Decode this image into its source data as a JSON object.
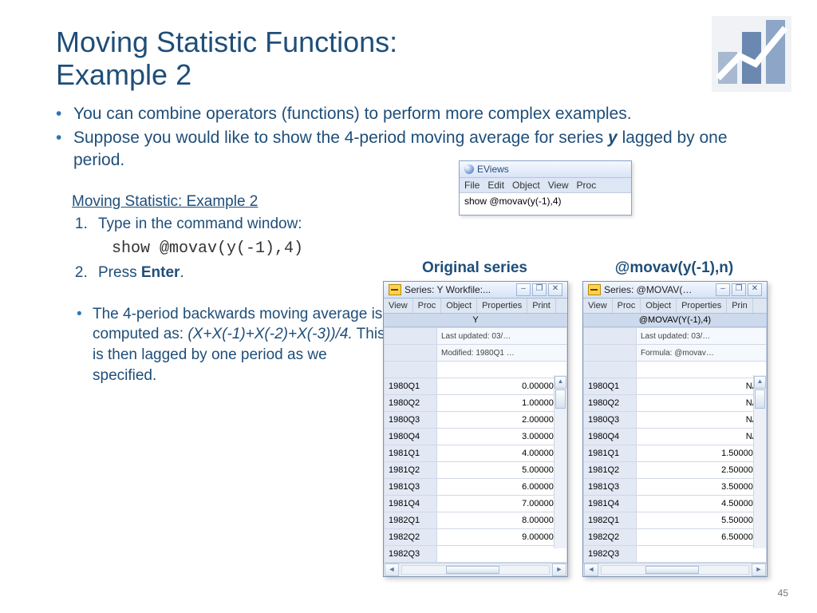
{
  "title": "Moving Statistic Functions:\nExample 2",
  "bullets": {
    "b1": "You can combine operators (functions) to perform more complex examples.",
    "b2a": "Suppose you would like to show the 4-period moving average for series ",
    "b2y": "y",
    "b2b": " lagged by one period."
  },
  "subhead": "Moving Statistic: Example 2",
  "steps": {
    "s1": "Type in the command window:",
    "code": "show @movav(y(-1),4)",
    "s2a": "Press ",
    "s2b": "Enter",
    "s2c": "."
  },
  "explain": {
    "a": "The 4-period backwards moving average is computed as: ",
    "formula": "(X+X(-1)+X(-2)+X(-3))/4.",
    "b": " This is then lagged by one period as we specified."
  },
  "cmdwin": {
    "title": "EViews",
    "menu": [
      "File",
      "Edit",
      "Object",
      "View",
      "Proc"
    ],
    "text": "show @movav(y(-1),4)"
  },
  "cols": {
    "orig": "Original series",
    "mov": "@movav(y(-1),n)"
  },
  "series_orig": {
    "title": "Series: Y   Workfile:...",
    "toolbar": [
      "View",
      "Proc",
      "Object",
      "Properties",
      "Print"
    ],
    "header": "Y",
    "info1": "Last updated: 03/…",
    "info2": "Modified: 1980Q1 …",
    "rows": [
      {
        "d": "1980Q1",
        "v": "0.000000"
      },
      {
        "d": "1980Q2",
        "v": "1.000000"
      },
      {
        "d": "1980Q3",
        "v": "2.000000"
      },
      {
        "d": "1980Q4",
        "v": "3.000000"
      },
      {
        "d": "1981Q1",
        "v": "4.000000"
      },
      {
        "d": "1981Q2",
        "v": "5.000000"
      },
      {
        "d": "1981Q3",
        "v": "6.000000"
      },
      {
        "d": "1981Q4",
        "v": "7.000000"
      },
      {
        "d": "1982Q1",
        "v": "8.000000"
      },
      {
        "d": "1982Q2",
        "v": "9.000000"
      },
      {
        "d": "1982Q3",
        "v": ""
      }
    ]
  },
  "series_mov": {
    "title": "Series: @MOVAV(…",
    "toolbar": [
      "View",
      "Proc",
      "Object",
      "Properties",
      "Prin"
    ],
    "header": "@MOVAV(Y(-1),4)",
    "info1": "Last updated: 03/…",
    "info2": "Formula: @movav…",
    "rows": [
      {
        "d": "1980Q1",
        "v": "NA"
      },
      {
        "d": "1980Q2",
        "v": "NA"
      },
      {
        "d": "1980Q3",
        "v": "NA"
      },
      {
        "d": "1980Q4",
        "v": "NA"
      },
      {
        "d": "1981Q1",
        "v": "1.500000"
      },
      {
        "d": "1981Q2",
        "v": "2.500000"
      },
      {
        "d": "1981Q3",
        "v": "3.500000"
      },
      {
        "d": "1981Q4",
        "v": "4.500000"
      },
      {
        "d": "1982Q1",
        "v": "5.500000"
      },
      {
        "d": "1982Q2",
        "v": "6.500000"
      },
      {
        "d": "1982Q3",
        "v": ""
      }
    ]
  },
  "pagenum": "45"
}
